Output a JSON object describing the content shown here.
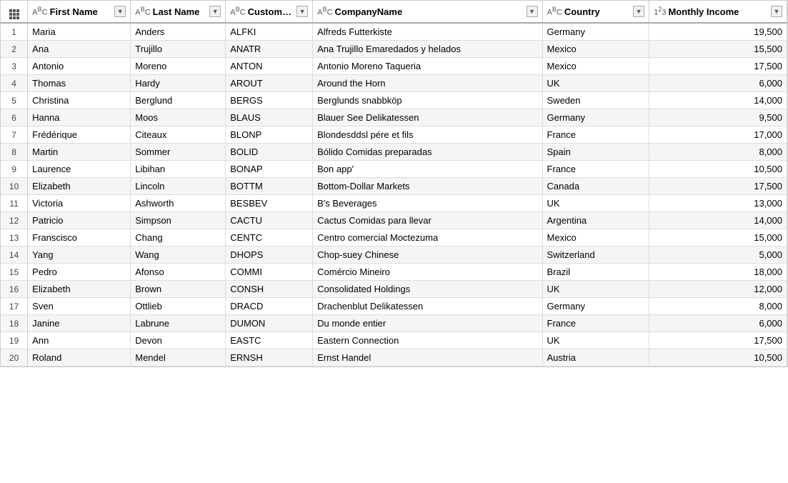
{
  "columns": [
    {
      "id": "idx",
      "label": "",
      "type": "",
      "filterable": false
    },
    {
      "id": "first",
      "label": "First Name",
      "type": "ABC",
      "filterable": true
    },
    {
      "id": "last",
      "label": "Last Name",
      "type": "ABC",
      "filterable": true
    },
    {
      "id": "cid",
      "label": "CustomerID",
      "type": "ABC",
      "filterable": true
    },
    {
      "id": "company",
      "label": "CompanyName",
      "type": "ABC",
      "filterable": true
    },
    {
      "id": "country",
      "label": "Country",
      "type": "ABC",
      "filterable": true
    },
    {
      "id": "income",
      "label": "Monthly Income",
      "type": "123",
      "filterable": true
    }
  ],
  "rows": [
    {
      "idx": 1,
      "first": "Maria",
      "last": "Anders",
      "cid": "ALFKI",
      "company": "Alfreds Futterkiste",
      "country": "Germany",
      "income": 19500
    },
    {
      "idx": 2,
      "first": "Ana",
      "last": "Trujillo",
      "cid": "ANATR",
      "company": "Ana Trujillo Emaredados y helados",
      "country": "Mexico",
      "income": 15500
    },
    {
      "idx": 3,
      "first": "Antonio",
      "last": "Moreno",
      "cid": "ANTON",
      "company": "Antonio Moreno Taqueria",
      "country": "Mexico",
      "income": 17500
    },
    {
      "idx": 4,
      "first": "Thomas",
      "last": "Hardy",
      "cid": "AROUT",
      "company": "Around the Horn",
      "country": "UK",
      "income": 6000
    },
    {
      "idx": 5,
      "first": "Christina",
      "last": "Berglund",
      "cid": "BERGS",
      "company": "Berglunds snabbköp",
      "country": "Sweden",
      "income": 14000
    },
    {
      "idx": 6,
      "first": "Hanna",
      "last": "Moos",
      "cid": "BLAUS",
      "company": "Blauer See Delikatessen",
      "country": "Germany",
      "income": 9500
    },
    {
      "idx": 7,
      "first": "Frédérique",
      "last": "Citeaux",
      "cid": "BLONP",
      "company": "Blondesddsl pére et fils",
      "country": "France",
      "income": 17000
    },
    {
      "idx": 8,
      "first": "Martin",
      "last": "Sommer",
      "cid": "BOLID",
      "company": "Bólido Comidas preparadas",
      "country": "Spain",
      "income": 8000
    },
    {
      "idx": 9,
      "first": "Laurence",
      "last": "Libihan",
      "cid": "BONAP",
      "company": "Bon app'",
      "country": "France",
      "income": 10500
    },
    {
      "idx": 10,
      "first": "Elizabeth",
      "last": "Lincoln",
      "cid": "BOTTM",
      "company": "Bottom-Dollar Markets",
      "country": "Canada",
      "income": 17500
    },
    {
      "idx": 11,
      "first": "Victoria",
      "last": "Ashworth",
      "cid": "BESBEV",
      "company": "B's Beverages",
      "country": "UK",
      "income": 13000
    },
    {
      "idx": 12,
      "first": "Patricio",
      "last": "Simpson",
      "cid": "CACTU",
      "company": "Cactus Comidas para llevar",
      "country": "Argentina",
      "income": 14000
    },
    {
      "idx": 13,
      "first": "Franscisco",
      "last": "Chang",
      "cid": "CENTC",
      "company": "Centro comercial Moctezuma",
      "country": "Mexico",
      "income": 15000
    },
    {
      "idx": 14,
      "first": "Yang",
      "last": "Wang",
      "cid": "DHOPS",
      "company": "Chop-suey Chinese",
      "country": "Switzerland",
      "income": 5000
    },
    {
      "idx": 15,
      "first": "Pedro",
      "last": "Afonso",
      "cid": "COMMI",
      "company": "Comércio Mineiro",
      "country": "Brazil",
      "income": 18000
    },
    {
      "idx": 16,
      "first": "Elizabeth",
      "last": "Brown",
      "cid": "CONSH",
      "company": "Consolidated Holdings",
      "country": "UK",
      "income": 12000
    },
    {
      "idx": 17,
      "first": "Sven",
      "last": "Ottlieb",
      "cid": "DRACD",
      "company": "Drachenblut Delikatessen",
      "country": "Germany",
      "income": 8000
    },
    {
      "idx": 18,
      "first": "Janine",
      "last": "Labrune",
      "cid": "DUMON",
      "company": "Du monde entier",
      "country": "France",
      "income": 6000
    },
    {
      "idx": 19,
      "first": "Ann",
      "last": "Devon",
      "cid": "EASTC",
      "company": "Eastern Connection",
      "country": "UK",
      "income": 17500
    },
    {
      "idx": 20,
      "first": "Roland",
      "last": "Mendel",
      "cid": "ERNSH",
      "company": "Ernst Handel",
      "country": "Austria",
      "income": 10500
    }
  ],
  "filter_arrow": "▼"
}
